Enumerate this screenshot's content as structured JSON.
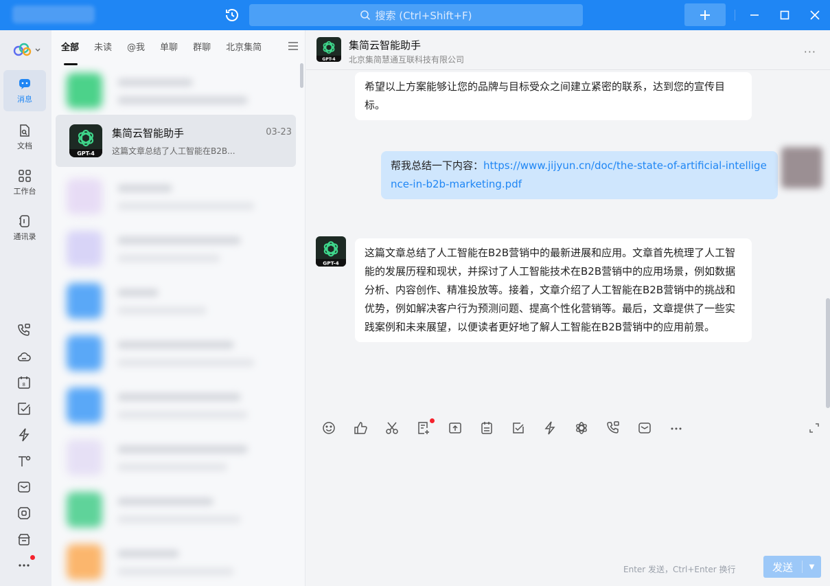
{
  "titlebar": {
    "search_placeholder": "搜索 (Ctrl+Shift+F)",
    "icons": [
      "history-icon",
      "search-icon",
      "plus-icon",
      "minimize-icon",
      "maximize-icon",
      "close-icon"
    ]
  },
  "rail": {
    "items": [
      {
        "label": "消息",
        "icon": "chat-icon",
        "active": true
      },
      {
        "label": "文档",
        "icon": "document-icon"
      },
      {
        "label": "工作台",
        "icon": "grid-icon"
      },
      {
        "label": "通讯录",
        "icon": "contacts-icon"
      }
    ],
    "bottom_icons": [
      "phone-icon",
      "cloud-icon",
      "calendar-icon",
      "task-icon",
      "lightning-icon",
      "mini-program-icon",
      "mail-icon",
      "meeting-icon",
      "archive-icon",
      "more-icon"
    ]
  },
  "convlist": {
    "tabs": [
      "全部",
      "未读",
      "@我",
      "单聊",
      "群聊",
      "北京集简"
    ],
    "active_tab": "全部",
    "active_conversation": {
      "name": "集简云智能助手",
      "date": "03-23",
      "preview": "这篇文章总结了人工智能在B2B...",
      "avatar_label": "GPT-4"
    }
  },
  "chat": {
    "title": "集简云智能助手",
    "subtitle": "北京集简慧通互联科技有限公司",
    "avatar_label": "GPT-4",
    "messages": [
      {
        "from": "bot",
        "text": "希望以上方案能够让您的品牌与目标受众之间建立紧密的联系，达到您的宣传目标。"
      },
      {
        "from": "me",
        "prefix": "帮我总结一下内容：",
        "link": "https://www.jijyun.cn/doc/the-state-of-artificial-intelligence-in-b2b-marketing.pdf"
      },
      {
        "from": "bot",
        "text": "这篇文章总结了人工智能在B2B营销中的最新进展和应用。文章首先梳理了人工智能的发展历程和现状，并探讨了人工智能技术在B2B营销中的应用场景，例如数据分析、内容创作、精准投放等。接着，文章介绍了人工智能在B2B营销中的挑战和优势，例如解决客户行为预测问题、提高个性化营销等。最后，文章提供了一些实践案例和未来展望，以便读者更好地了解人工智能在B2B营销中的应用前景。"
      }
    ]
  },
  "composer": {
    "tools": [
      "emoji-icon",
      "thumbs-up-icon",
      "scissors-icon",
      "doc-add-icon",
      "upload-icon",
      "clipboard-icon",
      "checkbox-icon",
      "lightning-icon",
      "chatgpt-icon",
      "phone-icon",
      "mail-icon",
      "more-icon"
    ],
    "hint": "Enter 发送，Ctrl+Enter 换行",
    "send_label": "发送"
  },
  "colors": {
    "brand": "#1f86f4",
    "notify": "#f5222d"
  }
}
